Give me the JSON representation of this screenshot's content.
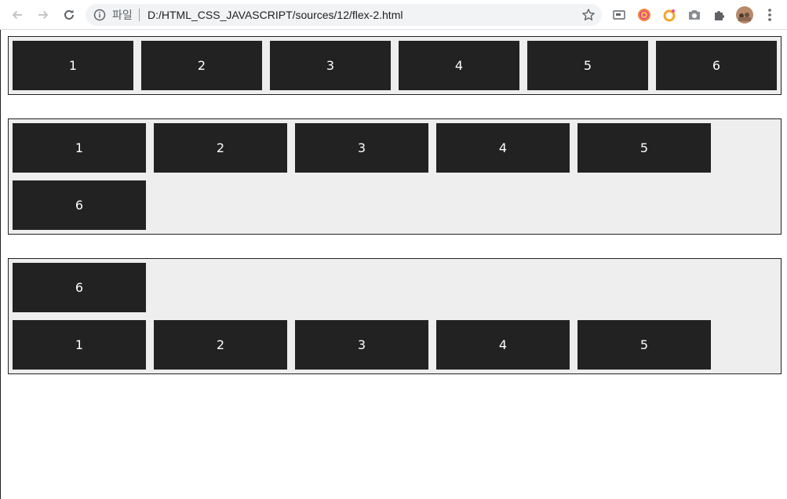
{
  "browser": {
    "omnibox": {
      "scheme_label": "파일",
      "url": "D:/HTML_CSS_JAVASCRIPT/sources/12/flex-2.html"
    }
  },
  "colors": {
    "item_bg": "#222222",
    "item_text": "#ffffff",
    "container_bg": "#eeeeee",
    "container_border": "#222222"
  },
  "containers": [
    {
      "items": [
        "1",
        "2",
        "3",
        "4",
        "5",
        "6"
      ]
    },
    {
      "items": [
        "1",
        "2",
        "3",
        "4",
        "5",
        "6"
      ]
    },
    {
      "items": [
        "6",
        "1",
        "2",
        "3",
        "4",
        "5"
      ]
    }
  ]
}
